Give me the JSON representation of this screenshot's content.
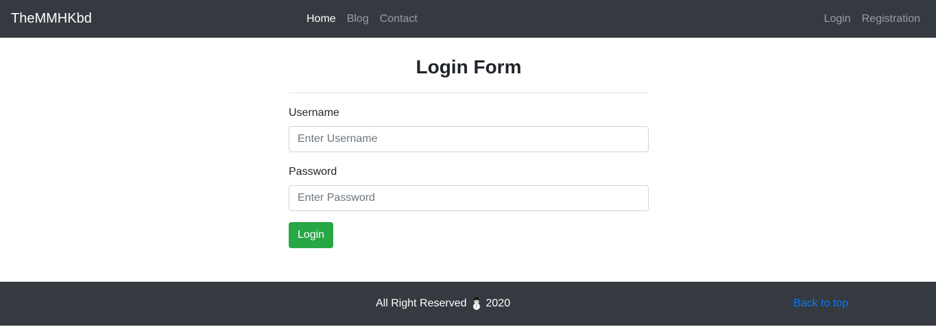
{
  "navbar": {
    "brand": "TheMMHKbd",
    "left_links": [
      {
        "label": "Home",
        "active": true
      },
      {
        "label": "Blog",
        "active": false
      },
      {
        "label": "Contact",
        "active": false
      }
    ],
    "right_links": [
      {
        "label": "Login"
      },
      {
        "label": "Registration"
      }
    ]
  },
  "form": {
    "title": "Login Form",
    "username_label": "Username",
    "username_placeholder": "Enter Username",
    "username_value": "",
    "password_label": "Password",
    "password_placeholder": "Enter Password",
    "password_value": "",
    "submit_label": "Login"
  },
  "footer": {
    "text_before": "All Right Reserved",
    "icon": "snowman-icon",
    "year": "2020",
    "back_to_top": "Back to top"
  },
  "colors": {
    "navbar_bg": "#343a40",
    "submit_bg": "#28a745",
    "link": "#007bff"
  }
}
